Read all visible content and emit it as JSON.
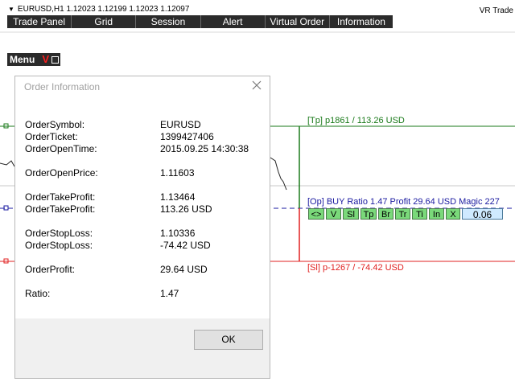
{
  "header": {
    "symbol_line": "EURUSD,H1  1.12023 1.12199 1.12023 1.12097",
    "app_title": "VR Trade"
  },
  "top_menu": [
    "Trade Panel",
    "Grid",
    "Session",
    "Alert",
    "Virtual Order",
    "Information"
  ],
  "menu_button": {
    "label": "Menu",
    "badge": "V"
  },
  "chart": {
    "tp_label": "[Tp]   p1861 / 113.26 USD",
    "op_label": "[Op] BUY  Ratio 1.47  Profit 29.64 USD  Magic 227",
    "sl_label": "[Sl]   p-1267 / -74.42 USD",
    "buttons": [
      "<>",
      "V",
      "Sl",
      "Tp",
      "Br",
      "Tr",
      "Ti",
      "In",
      "X"
    ],
    "lot_value": "0.06",
    "colors": {
      "tp": "#1a7a1a",
      "op": "#1a1aa0",
      "sl": "#e02020",
      "button": "#7ad97a"
    }
  },
  "dialog": {
    "title": "Order Information",
    "ok_label": "OK",
    "rows": [
      {
        "key": "OrderSymbol:",
        "value": "EURUSD"
      },
      {
        "key": "OrderTicket:",
        "value": "1399427406"
      },
      {
        "key": "OrderOpenTime:",
        "value": "2015.09.25 14:30:38"
      },
      {
        "key": "OrderOpenPrice:",
        "value": "1.11603"
      },
      {
        "key": "OrderTakeProfit:",
        "value": "1.13464"
      },
      {
        "key": "OrderTakeProfit:",
        "value": "113.26 USD"
      },
      {
        "key": "OrderStopLoss:",
        "value": "1.10336"
      },
      {
        "key": "OrderStopLoss:",
        "value": "-74.42 USD"
      },
      {
        "key": "OrderProfit:",
        "value": "29.64 USD"
      },
      {
        "key": "Ratio:",
        "value": "1.47"
      }
    ]
  }
}
